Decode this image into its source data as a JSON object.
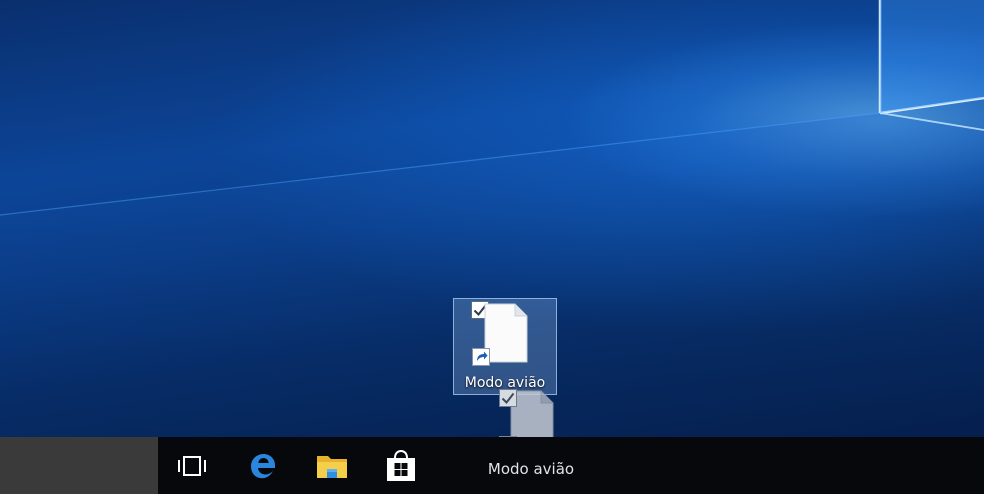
{
  "desktop": {
    "icons": [
      {
        "label": "Modo avião",
        "icon": "shortcut-file-icon",
        "selected": true,
        "checked": true
      }
    ]
  },
  "drag": {
    "label": "Modo avião",
    "icon": "shortcut-file-icon"
  },
  "taskbar": {
    "search_area": "search-box",
    "buttons": [
      {
        "name": "task-view-button",
        "icon": "task-view-icon"
      },
      {
        "name": "edge-button",
        "icon": "edge-icon",
        "color": "#1e7fd8"
      },
      {
        "name": "file-explorer-button",
        "icon": "folder-icon",
        "color": "#f4c542"
      },
      {
        "name": "store-button",
        "icon": "store-icon",
        "color": "#ffffff"
      }
    ],
    "background": "#06080c"
  }
}
